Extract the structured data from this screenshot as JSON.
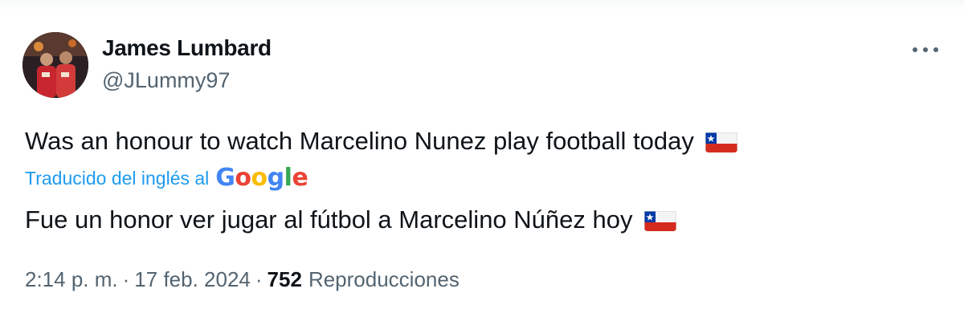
{
  "author": {
    "display_name": "James Lumbard",
    "handle": "@JLummy97"
  },
  "more_icon": "more-horizontal-icon",
  "tweet": {
    "text": "Was an honour to watch Marcelino Nunez play football today",
    "flag_icon": "chile-flag-icon",
    "translated_label": "Traducido del inglés al",
    "translation_provider": "Google",
    "translated_text": "Fue un honor ver jugar al fútbol a Marcelino Núñez hoy"
  },
  "meta": {
    "time": "2:14 p. m.",
    "separator": "·",
    "date": "17 feb. 2024",
    "views_count": "752",
    "views_label": "Reproducciones"
  },
  "colors": {
    "text": "#0f1419",
    "secondary": "#536471",
    "link": "#1d9bf0",
    "google_blue": "#4285f4",
    "google_red": "#ea4335",
    "google_yellow": "#fbbc05",
    "google_green": "#34a853",
    "chile_red": "#d52b1e",
    "chile_blue": "#0039a6"
  }
}
